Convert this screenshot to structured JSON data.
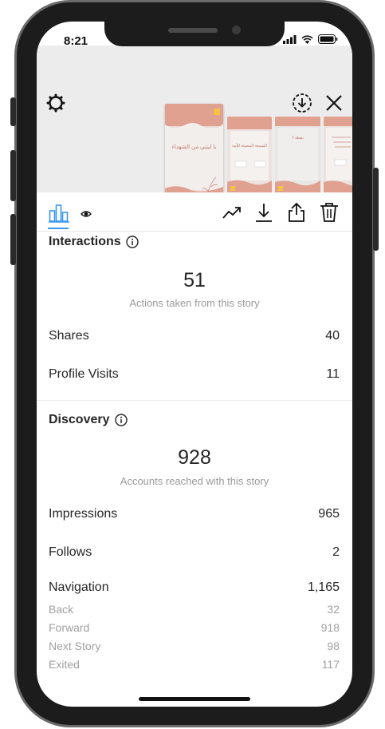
{
  "status_bar": {
    "time": "8:21"
  },
  "story_previews": {
    "main_caption": "يا ليتني من الشهداء",
    "thumb2_caption": "الشمعة المضيئة للأمة",
    "thumb3_caption": "نقطة 7"
  },
  "tabs": {
    "insights_icon": "bar-chart-icon",
    "viewers_icon": "eye-icon"
  },
  "interactions": {
    "title": "Interactions",
    "total": "51",
    "caption": "Actions taken from this story",
    "rows": [
      {
        "label": "Shares",
        "value": "40"
      },
      {
        "label": "Profile Visits",
        "value": "11"
      }
    ]
  },
  "discovery": {
    "title": "Discovery",
    "total": "928",
    "caption": "Accounts reached with this story",
    "rows": [
      {
        "label": "Impressions",
        "value": "965"
      },
      {
        "label": "Follows",
        "value": "2"
      },
      {
        "label": "Navigation",
        "value": "1,165"
      }
    ],
    "navigation_breakdown": [
      {
        "label": "Back",
        "value": "32"
      },
      {
        "label": "Forward",
        "value": "918"
      },
      {
        "label": "Next Story",
        "value": "98"
      },
      {
        "label": "Exited",
        "value": "117"
      }
    ]
  },
  "colors": {
    "accent": "#3897f0",
    "story_peach": "#e0a191"
  }
}
